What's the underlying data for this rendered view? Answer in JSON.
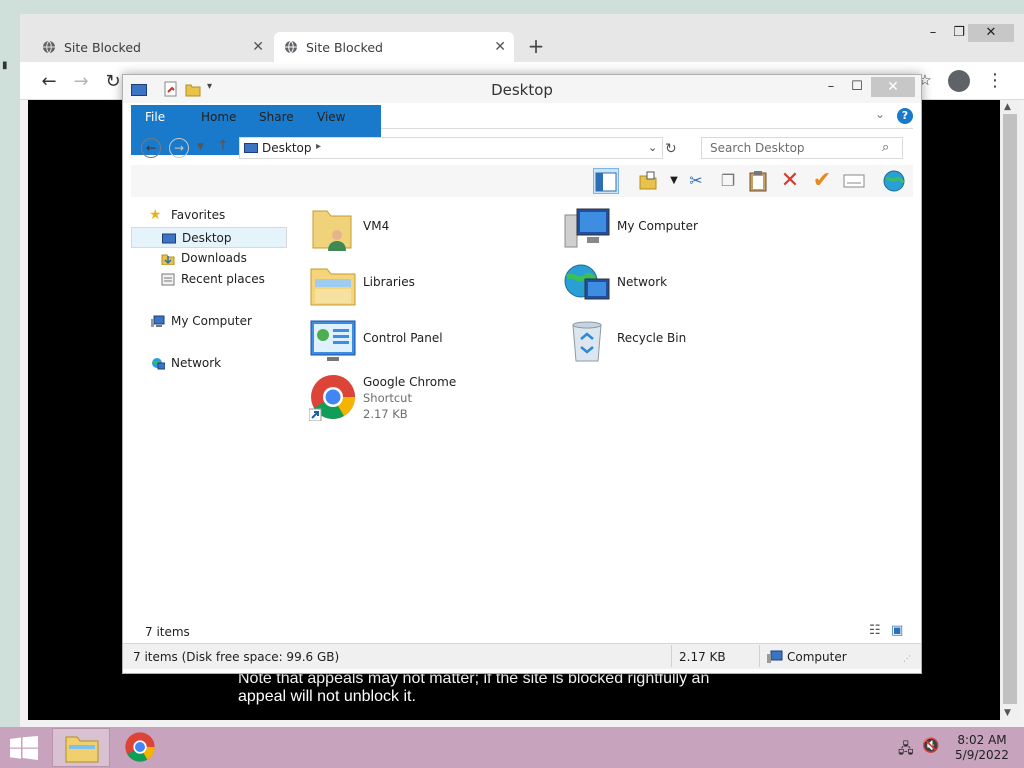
{
  "browser": {
    "tabs": [
      {
        "label": "Site Blocked"
      },
      {
        "label": "Site Blocked"
      }
    ],
    "notice": "Note that appeals may not matter; if the site is blocked rightfully an appeal will not unblock it."
  },
  "explorer": {
    "title": "Desktop",
    "ribbon_tabs": [
      "File",
      "Home",
      "Share",
      "View"
    ],
    "address": {
      "crumb": "Desktop"
    },
    "search": {
      "placeholder": "Search Desktop"
    },
    "nav": {
      "favorites": "Favorites",
      "items": [
        "Desktop",
        "Downloads",
        "Recent places"
      ],
      "my_computer": "My Computer",
      "network": "Network"
    },
    "files": [
      {
        "name": "VM4",
        "icon": "user-folder-icon"
      },
      {
        "name": "My Computer",
        "icon": "computer-icon"
      },
      {
        "name": "Libraries",
        "icon": "libraries-icon"
      },
      {
        "name": "Network",
        "icon": "network-icon"
      },
      {
        "name": "Control Panel",
        "icon": "control-panel-icon"
      },
      {
        "name": "Recycle Bin",
        "icon": "recycle-bin-icon"
      },
      {
        "name": "Google Chrome",
        "sub1": "Shortcut",
        "sub2": "2.17 KB",
        "icon": "chrome-icon"
      }
    ],
    "item_count": "7 items",
    "status": {
      "left": "7 items (Disk free space: 99.6 GB)",
      "size": "2.17 KB",
      "location": "Computer"
    }
  },
  "taskbar": {
    "time": "8:02 AM",
    "date": "5/9/2022"
  },
  "colors": {
    "accent": "#1979ca",
    "taskbar": "#c8a3bd",
    "selection": "#cce4f7"
  }
}
